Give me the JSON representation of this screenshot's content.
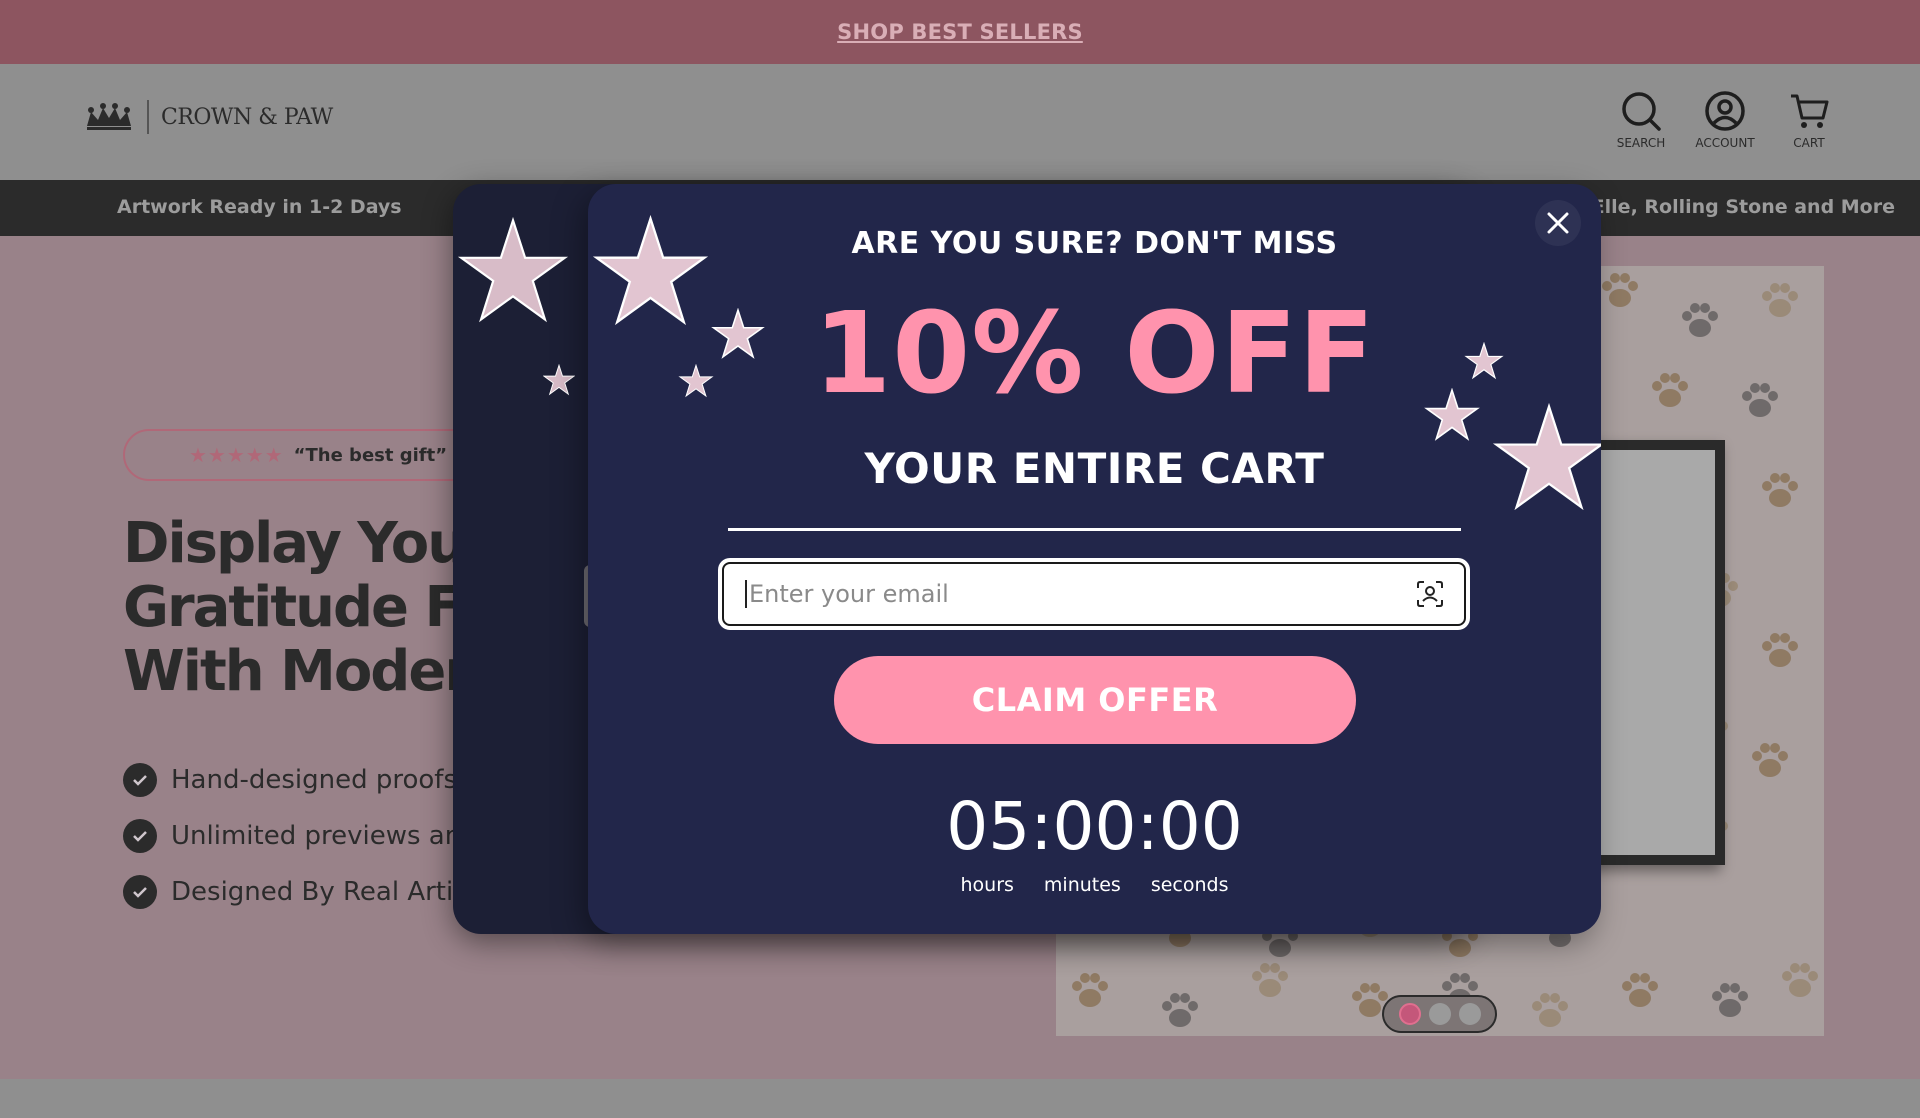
{
  "announcement": {
    "link_text": "SHOP BEST SELLERS"
  },
  "header": {
    "brand": "CROWN & PAW",
    "icons": [
      {
        "name": "search-icon",
        "label": "SEARCH"
      },
      {
        "name": "account-icon",
        "label": "ACCOUNT"
      },
      {
        "name": "cart-icon",
        "label": "CART"
      }
    ]
  },
  "usp_bar": {
    "left": "Artwork Ready in 1-2 Days",
    "right": "ue, Elle, Rolling Stone and More"
  },
  "hero": {
    "review_stars": "★★★★★",
    "review_quote": "“The best gift”",
    "headline": [
      "Display Your",
      "Gratitude Fo",
      "With Modern"
    ],
    "bullets": [
      "Hand-designed proofs",
      "Unlimited previews anc",
      "Designed By Real Artist"
    ],
    "carousel": {
      "count": 3,
      "active": 1
    }
  },
  "popup": {
    "pre_title": "ARE YOU SURE? DON'T MISS",
    "offer": "10% OFF",
    "subtitle": "YOUR ENTIRE CART",
    "email_placeholder": "Enter your email",
    "email_value": "",
    "cta": "CLAIM OFFER",
    "timer": "05:00:00",
    "units": [
      "hours",
      "minutes",
      "seconds"
    ]
  },
  "colors": {
    "announcement_bg": "#8d5560",
    "popup_bg": "#22264a",
    "accent_pink": "#ff93ad",
    "dark_bar": "#2b2b2b"
  }
}
